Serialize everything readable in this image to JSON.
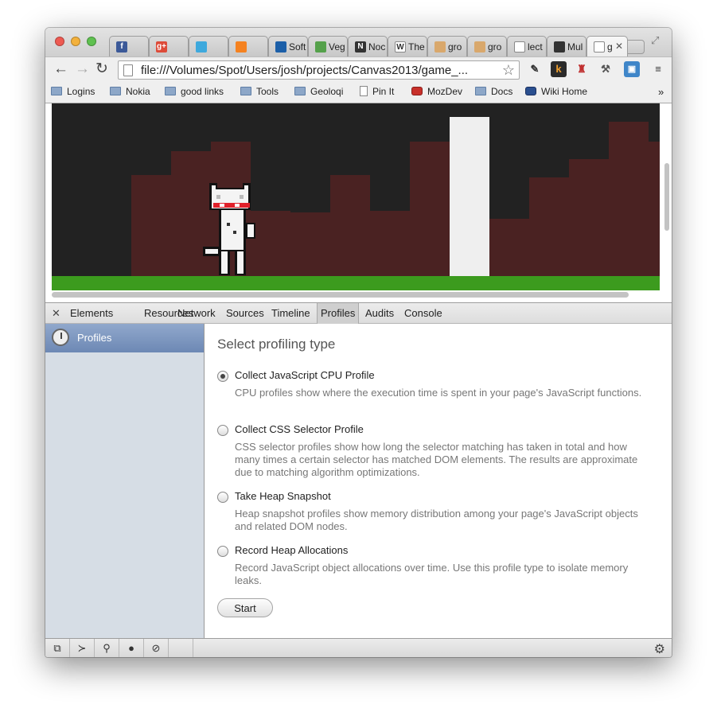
{
  "tabs": [
    {
      "favicon": "facebook-icon",
      "fav_text": "f",
      "color": "#3b5998",
      "title": ""
    },
    {
      "favicon": "google-plus-icon",
      "fav_text": "g+",
      "color": "#dd4b39",
      "title": ""
    },
    {
      "favicon": "twitter-icon",
      "fav_text": "",
      "color": "#3ea9dd",
      "title": ""
    },
    {
      "favicon": "chart-icon",
      "fav_text": "",
      "color": "#f58220",
      "title": ""
    },
    {
      "favicon": "power-icon",
      "fav_text": "",
      "color": "#1c5fa8",
      "title": "Soft"
    },
    {
      "favicon": "chrome-icon",
      "fav_text": "",
      "color": "#55a14b",
      "title": "Veg"
    },
    {
      "favicon": "n-icon",
      "fav_text": "N",
      "color": "#333333",
      "title": "Noc"
    },
    {
      "favicon": "wikipedia-icon",
      "fav_text": "W",
      "color": "#ffffff",
      "title": "The"
    },
    {
      "favicon": "pencil-icon",
      "fav_text": "",
      "color": "#d9a86c",
      "title": "gro"
    },
    {
      "favicon": "pencil-icon",
      "fav_text": "",
      "color": "#d9a86c",
      "title": "gro"
    },
    {
      "favicon": "page-icon",
      "fav_text": "",
      "color": "#ffffff",
      "title": "lect"
    },
    {
      "favicon": "grid-icon",
      "fav_text": "",
      "color": "#333333",
      "title": "Mul"
    },
    {
      "favicon": "page-icon",
      "fav_text": "",
      "color": "#ffffff",
      "title": "g"
    }
  ],
  "toolbar": {
    "url": "file:///Volumes/Spot/Users/josh/projects/Canvas2013/game_..."
  },
  "bookmarks": [
    {
      "label": "Logins",
      "icon": "folder-icon"
    },
    {
      "label": "Nokia",
      "icon": "folder-icon"
    },
    {
      "label": "good links",
      "icon": "folder-icon"
    },
    {
      "label": "Tools",
      "icon": "folder-icon"
    },
    {
      "label": "Geoloqi",
      "icon": "folder-icon"
    },
    {
      "label": "Pin It",
      "icon": "page-icon"
    },
    {
      "label": "MozDev",
      "icon": "dino-icon"
    },
    {
      "label": "Docs",
      "icon": "folder-icon"
    },
    {
      "label": "Wiki Home",
      "icon": "wiki-icon"
    }
  ],
  "devtools": {
    "tabs": [
      "Elements",
      "Resources",
      "Network",
      "Sources",
      "Timeline",
      "Profiles",
      "Audits",
      "Console"
    ],
    "selected_tab": "Profiles",
    "sidebar_label": "Profiles",
    "panel_title": "Select profiling type",
    "options": [
      {
        "label": "Collect JavaScript CPU Profile",
        "desc": "CPU profiles show where the execution time is spent in your page's JavaScript functions.",
        "selected": true
      },
      {
        "label": "Collect CSS Selector Profile",
        "desc": "CSS selector profiles show how long the selector matching has taken in total and how many times a certain selector has matched DOM elements. The results are approximate due to matching algorithm optimizations.",
        "selected": false
      },
      {
        "label": "Take Heap Snapshot",
        "desc": "Heap snapshot profiles show memory distribution among your page's JavaScript objects and related DOM nodes.",
        "selected": false
      },
      {
        "label": "Record Heap Allocations",
        "desc": "Record JavaScript object allocations over time. Use this profile type to isolate memory leaks.",
        "selected": false
      }
    ],
    "start_label": "Start"
  },
  "colors": {
    "game_bg": "#222222",
    "wall": "#4a2222",
    "grass": "#3c9b1e",
    "pillar": "#efefef",
    "headband": "#e0202a"
  }
}
